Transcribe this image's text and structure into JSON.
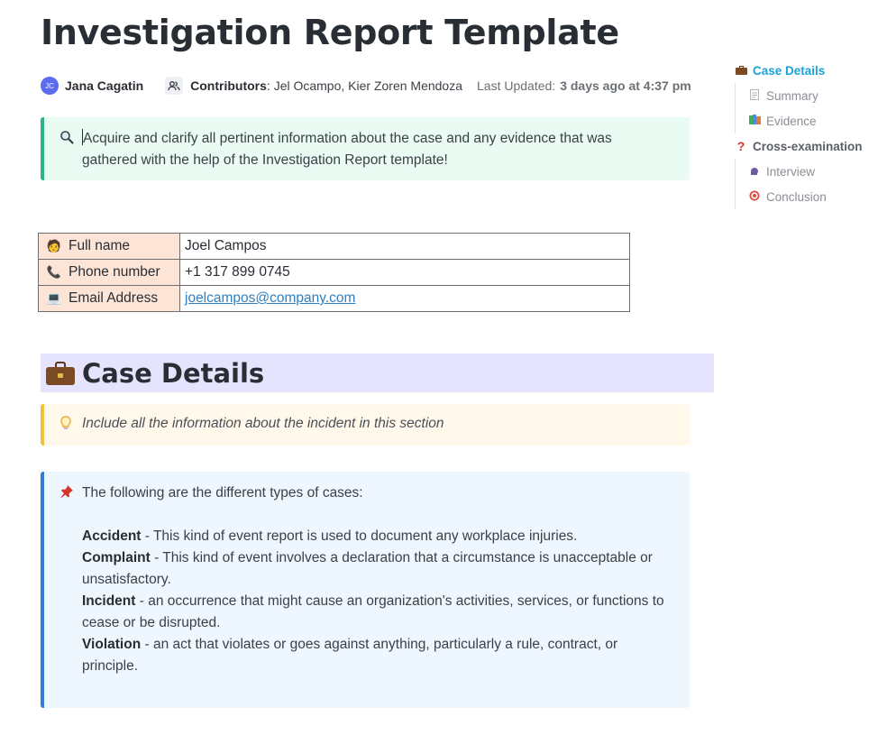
{
  "page": {
    "title": "Investigation Report Template"
  },
  "meta": {
    "author_initials": "JC",
    "author_name": "Jana Cagatin",
    "contributors_label": "Contributors",
    "contributors_names": "Jel Ocampo, Kier Zoren Mendoza",
    "last_updated_label": "Last Updated:",
    "last_updated_value": "3 days ago at 4:37 pm"
  },
  "intro_callout": {
    "icon": "magnifying-glass-icon",
    "text": "Acquire and clarify all pertinent information about the case and any evidence that was gathered with the help of the Investigation Report template!"
  },
  "info_table": {
    "rows": [
      {
        "icon": "person-icon",
        "label": "Full name",
        "value": "Joel Campos"
      },
      {
        "icon": "telephone-icon",
        "label": "Phone number",
        "value": "+1 317 899 0745"
      },
      {
        "icon": "computer-icon",
        "label": "Email Address",
        "value": "joelcampos@company.com"
      }
    ]
  },
  "case_details": {
    "icon": "briefcase-icon",
    "heading": "Case Details",
    "tip": "Include all the information about the incident in this section",
    "types_intro": "The following are the different types of cases:",
    "types": [
      {
        "term": "Accident",
        "desc": " - This kind of event report is used to document any workplace injuries."
      },
      {
        "term": "Complaint",
        "desc": " - This kind of event involves a declaration that a circumstance is unacceptable or unsatisfactory."
      },
      {
        "term": "Incident",
        "desc": " - an occurrence that might cause an organization's activities, services, or functions to cease or be disrupted."
      },
      {
        "term": "Violation",
        "desc": " - an act that violates or goes against anything, particularly a rule, contract, or principle."
      }
    ]
  },
  "toc": {
    "items": [
      {
        "icon": "briefcase-icon",
        "label": "Case Details",
        "level": 1,
        "active": true
      },
      {
        "icon": "page-icon",
        "label": "Summary",
        "level": 2
      },
      {
        "icon": "books-icon",
        "label": "Evidence",
        "level": 2
      },
      {
        "icon": "question-mark-icon",
        "label": "Cross-examination",
        "level": 1
      },
      {
        "icon": "speaking-head-icon",
        "label": "Interview",
        "level": 2
      },
      {
        "icon": "target-icon",
        "label": "Conclusion",
        "level": 2
      }
    ]
  },
  "colors": {
    "accent_toc": "#1ba1d8",
    "intro_callout_bg": "#eafbf3",
    "intro_callout_border": "#2cb67d",
    "table_label_bg": "#fce4d6",
    "heading_bg": "#e5e3fd",
    "tip_callout_bg": "#fff8eb",
    "tip_callout_border": "#f0c040",
    "types_callout_bg": "#eef6fe",
    "types_callout_border": "#2f7fd8",
    "link": "#2f80c3"
  }
}
